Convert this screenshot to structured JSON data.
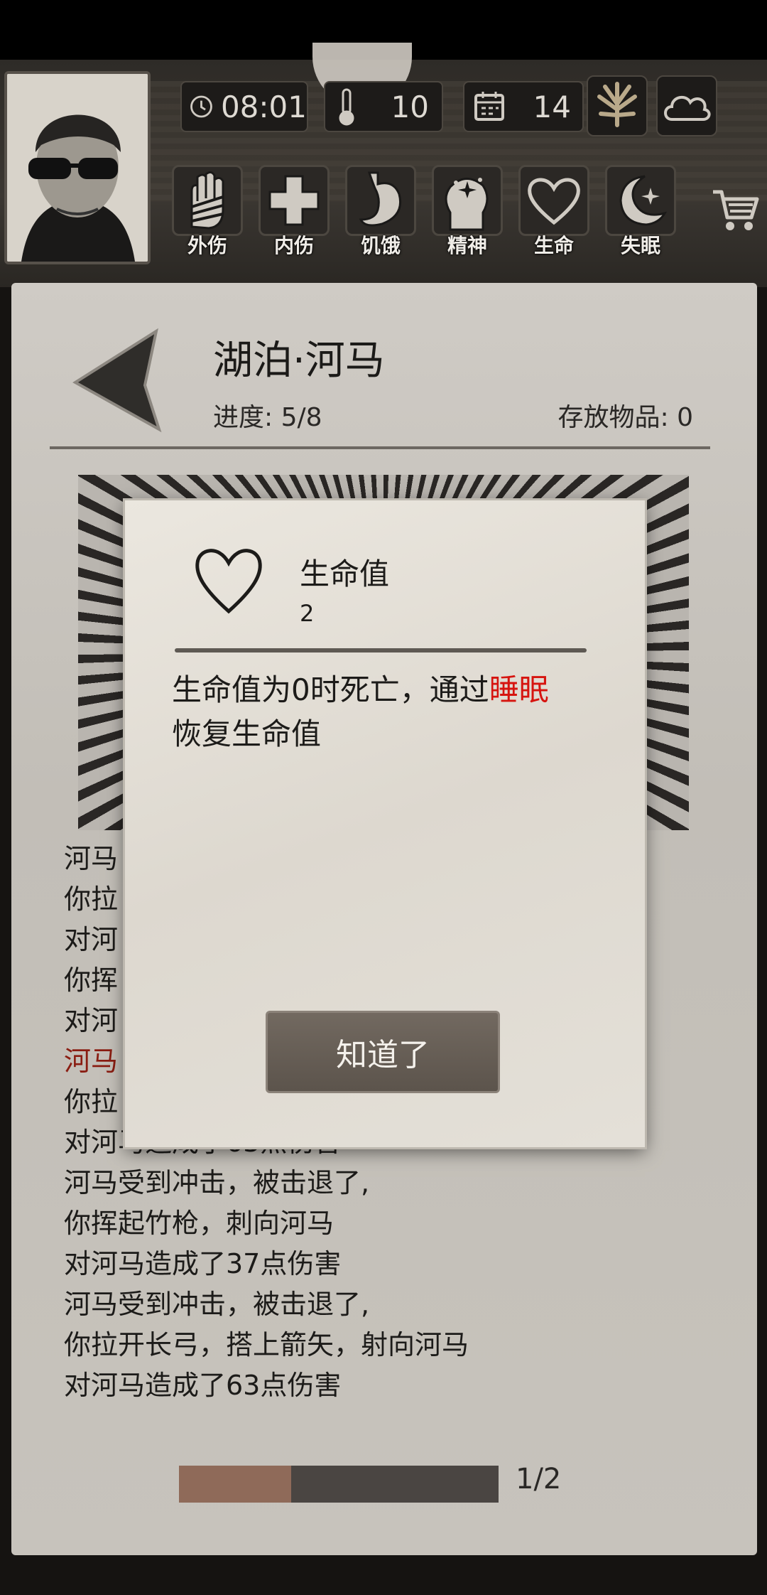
{
  "hud": {
    "time": "08:01",
    "temperature": "10",
    "day": "14",
    "stats": [
      {
        "label": "外伤"
      },
      {
        "label": "内伤"
      },
      {
        "label": "饥饿"
      },
      {
        "label": "精神"
      },
      {
        "label": "生命"
      },
      {
        "label": "失眠"
      }
    ]
  },
  "location": {
    "title": "湖泊·河马",
    "progress": "进度: 5/8",
    "stored": "存放物品: 0"
  },
  "log": [
    {
      "text": "河马",
      "color": "normal"
    },
    {
      "text": "你拉",
      "color": "normal"
    },
    {
      "text": "对河",
      "color": "normal"
    },
    {
      "text": "你挥",
      "color": "normal"
    },
    {
      "text": "对河",
      "color": "normal"
    },
    {
      "text": "河马",
      "color": "red"
    },
    {
      "text": "你拉",
      "color": "normal"
    },
    {
      "text": "对河马造成了63点伤害",
      "color": "normal"
    },
    {
      "text": " 河马受到冲击，被击退了,",
      "color": "normal"
    },
    {
      "text": "你挥起竹枪，刺向河马",
      "color": "normal"
    },
    {
      "text": "对河马造成了37点伤害",
      "color": "normal"
    },
    {
      "text": " 河马受到冲击，被击退了,",
      "color": "normal"
    },
    {
      "text": "你拉开长弓，搭上箭矢，射向河马",
      "color": "normal"
    },
    {
      "text": "对河马造成了63点伤害",
      "color": "normal"
    }
  ],
  "pager": {
    "page": "1/2",
    "fill_fraction": 0.35
  },
  "modal": {
    "title": "生命值",
    "value": "2",
    "desc_before": "生命值为0时死亡，通过",
    "desc_highlight": "睡眠",
    "desc_after": "恢复生命值",
    "button": "知道了",
    "highlight_color": "#d6140f"
  }
}
